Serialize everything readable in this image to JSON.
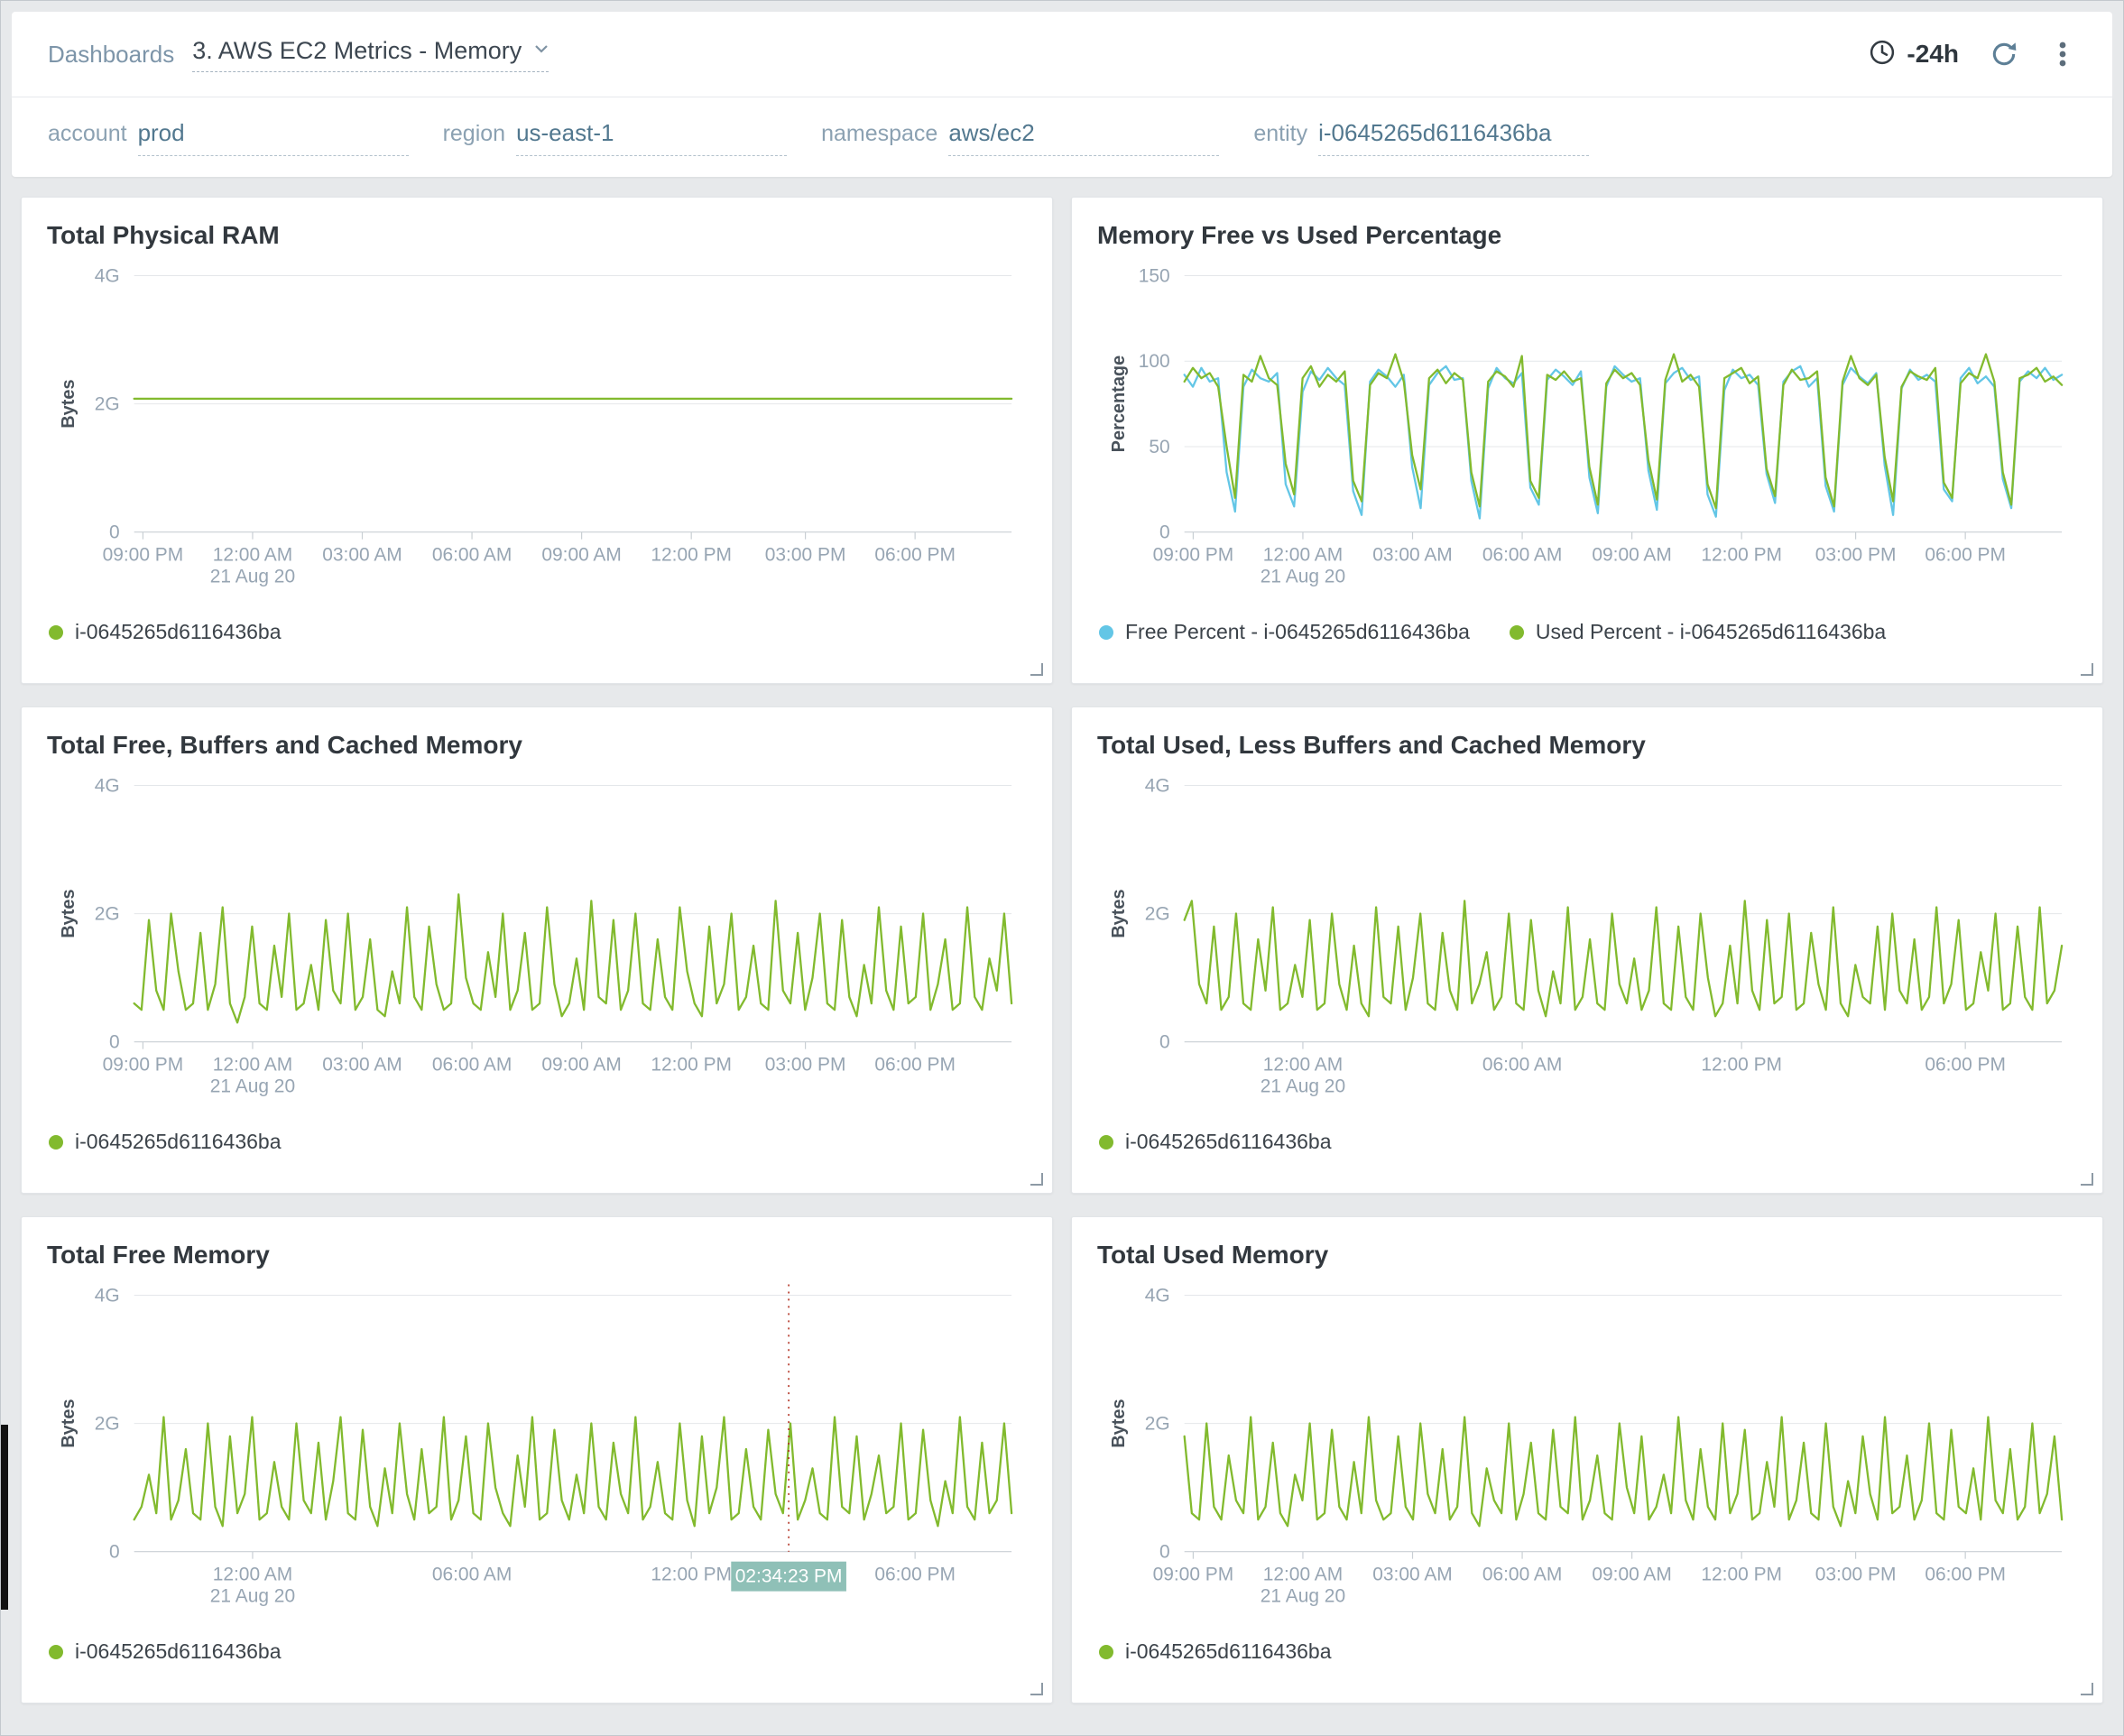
{
  "header": {
    "breadcrumb": "Dashboards",
    "dashboard_title": "3. AWS EC2 Metrics - Memory",
    "time_range": "-24h"
  },
  "filters": [
    {
      "label": "account",
      "value": "prod"
    },
    {
      "label": "region",
      "value": "us-east-1"
    },
    {
      "label": "namespace",
      "value": "aws/ec2"
    },
    {
      "label": "entity",
      "value": "i-0645265d6116436ba"
    }
  ],
  "colors": {
    "green": "#82ba2e",
    "blue": "#63c6e6",
    "cursor_red": "#b23121",
    "cursor_tag_bg": "#8fc0b7"
  },
  "chart_data": [
    {
      "type": "line",
      "title": "Total Physical RAM",
      "ylabel": "Bytes",
      "ymax": 4,
      "yticks": [
        {
          "value": 0,
          "label": "0"
        },
        {
          "value": 2,
          "label": "2G"
        },
        {
          "value": 4,
          "label": "4G"
        }
      ],
      "xticks": [
        {
          "pos": 0.01,
          "label": "09:00 PM"
        },
        {
          "pos": 0.135,
          "label": "12:00 AM",
          "sub": "21 Aug 20"
        },
        {
          "pos": 0.26,
          "label": "03:00 AM"
        },
        {
          "pos": 0.385,
          "label": "06:00 AM"
        },
        {
          "pos": 0.51,
          "label": "09:00 AM"
        },
        {
          "pos": 0.635,
          "label": "12:00 PM"
        },
        {
          "pos": 0.765,
          "label": "03:00 PM"
        },
        {
          "pos": 0.89,
          "label": "06:00 PM"
        }
      ],
      "series": [
        {
          "name": "i-0645265d6116436ba",
          "color": "#82ba2e",
          "values": [
            2.08,
            2.08,
            2.08,
            2.08,
            2.08,
            2.08,
            2.08,
            2.08,
            2.08,
            2.08,
            2.08,
            2.08
          ]
        }
      ]
    },
    {
      "type": "line",
      "title": "Memory Free vs Used Percentage",
      "ylabel": "Percentage",
      "ymax": 150,
      "yticks": [
        {
          "value": 0,
          "label": "0"
        },
        {
          "value": 50,
          "label": "50"
        },
        {
          "value": 100,
          "label": "100"
        },
        {
          "value": 150,
          "label": "150"
        }
      ],
      "xticks": [
        {
          "pos": 0.01,
          "label": "09:00 PM"
        },
        {
          "pos": 0.135,
          "label": "12:00 AM",
          "sub": "21 Aug 20"
        },
        {
          "pos": 0.26,
          "label": "03:00 AM"
        },
        {
          "pos": 0.385,
          "label": "06:00 AM"
        },
        {
          "pos": 0.51,
          "label": "09:00 AM"
        },
        {
          "pos": 0.635,
          "label": "12:00 PM"
        },
        {
          "pos": 0.765,
          "label": "03:00 PM"
        },
        {
          "pos": 0.89,
          "label": "06:00 PM"
        }
      ],
      "series": [
        {
          "name": "Free Percent - i-0645265d6116436ba",
          "color": "#63c6e6",
          "values": [
            92,
            85,
            96,
            88,
            90,
            35,
            12,
            85,
            95,
            90,
            88,
            93,
            28,
            15,
            82,
            94,
            89,
            96,
            90,
            86,
            24,
            10,
            88,
            95,
            91,
            85,
            92,
            38,
            14,
            86,
            93,
            97,
            89,
            90,
            30,
            8,
            84,
            96,
            90,
            87,
            93,
            26,
            16,
            89,
            95,
            91,
            86,
            94,
            32,
            11,
            85,
            97,
            92,
            88,
            90,
            36,
            13,
            87,
            93,
            96,
            89,
            91,
            22,
            9,
            83,
            95,
            90,
            92,
            86,
            34,
            17,
            88,
            94,
            97,
            85,
            90,
            27,
            12,
            86,
            96,
            91,
            87,
            93,
            39,
            10,
            84,
            95,
            89,
            92,
            88,
            25,
            18,
            90,
            96,
            87,
            91,
            85,
            31,
            14,
            88,
            94,
            90,
            96,
            89,
            92
          ]
        },
        {
          "name": "Used Percent - i-0645265d6116436ba",
          "color": "#82ba2e",
          "values": [
            88,
            96,
            90,
            93,
            85,
            50,
            20,
            92,
            88,
            103,
            90,
            86,
            40,
            22,
            90,
            97,
            85,
            92,
            88,
            94,
            30,
            18,
            86,
            93,
            90,
            104,
            88,
            45,
            25,
            90,
            95,
            87,
            93,
            89,
            35,
            15,
            88,
            94,
            91,
            85,
            103,
            30,
            20,
            92,
            89,
            94,
            88,
            90,
            38,
            16,
            87,
            95,
            90,
            93,
            86,
            42,
            19,
            89,
            104,
            88,
            92,
            85,
            28,
            14,
            90,
            93,
            96,
            87,
            91,
            37,
            21,
            86,
            95,
            89,
            90,
            94,
            32,
            15,
            88,
            103,
            90,
            86,
            92,
            44,
            18,
            85,
            94,
            91,
            89,
            96,
            29,
            20,
            87,
            93,
            90,
            104,
            88,
            35,
            16,
            90,
            92,
            96,
            88,
            91,
            86
          ]
        }
      ]
    },
    {
      "type": "line",
      "title": "Total Free, Buffers and Cached Memory",
      "ylabel": "Bytes",
      "ymax": 4,
      "yticks": [
        {
          "value": 0,
          "label": "0"
        },
        {
          "value": 2,
          "label": "2G"
        },
        {
          "value": 4,
          "label": "4G"
        }
      ],
      "xticks": [
        {
          "pos": 0.01,
          "label": "09:00 PM"
        },
        {
          "pos": 0.135,
          "label": "12:00 AM",
          "sub": "21 Aug 20"
        },
        {
          "pos": 0.26,
          "label": "03:00 AM"
        },
        {
          "pos": 0.385,
          "label": "06:00 AM"
        },
        {
          "pos": 0.51,
          "label": "09:00 AM"
        },
        {
          "pos": 0.635,
          "label": "12:00 PM"
        },
        {
          "pos": 0.765,
          "label": "03:00 PM"
        },
        {
          "pos": 0.89,
          "label": "06:00 PM"
        }
      ],
      "series": [
        {
          "name": "i-0645265d6116436ba",
          "color": "#82ba2e",
          "values": [
            0.6,
            0.5,
            1.9,
            0.8,
            0.5,
            2.0,
            1.1,
            0.5,
            0.6,
            1.7,
            0.5,
            0.9,
            2.1,
            0.6,
            0.3,
            0.7,
            1.8,
            0.6,
            0.5,
            1.5,
            0.7,
            2.0,
            0.5,
            0.6,
            1.2,
            0.5,
            1.9,
            0.8,
            0.6,
            2.0,
            0.5,
            0.7,
            1.6,
            0.5,
            0.4,
            1.1,
            0.6,
            2.1,
            0.7,
            0.5,
            1.8,
            0.9,
            0.5,
            0.6,
            2.3,
            1.0,
            0.6,
            0.5,
            1.4,
            0.7,
            2.0,
            0.5,
            0.8,
            1.7,
            0.5,
            0.6,
            2.1,
            0.9,
            0.4,
            0.6,
            1.3,
            0.5,
            2.2,
            0.7,
            0.6,
            1.9,
            0.5,
            0.8,
            2.0,
            0.6,
            0.5,
            1.6,
            0.7,
            0.5,
            2.1,
            1.1,
            0.6,
            0.4,
            1.8,
            0.6,
            0.9,
            2.0,
            0.5,
            0.7,
            1.5,
            0.6,
            0.5,
            2.2,
            0.8,
            0.6,
            1.7,
            0.5,
            1.0,
            2.0,
            0.6,
            0.5,
            1.9,
            0.7,
            0.4,
            1.2,
            0.6,
            2.1,
            0.8,
            0.5,
            1.8,
            0.6,
            0.7,
            2.0,
            0.5,
            0.9,
            1.6,
            0.5,
            0.6,
            2.1,
            0.7,
            0.5,
            1.3,
            0.8,
            2.0,
            0.6
          ]
        }
      ]
    },
    {
      "type": "line",
      "title": "Total Used, Less Buffers and Cached Memory",
      "ylabel": "Bytes",
      "ymax": 4,
      "yticks": [
        {
          "value": 0,
          "label": "0"
        },
        {
          "value": 2,
          "label": "2G"
        },
        {
          "value": 4,
          "label": "4G"
        }
      ],
      "xticks": [
        {
          "pos": 0.135,
          "label": "12:00 AM",
          "sub": "21 Aug 20"
        },
        {
          "pos": 0.385,
          "label": "06:00 AM"
        },
        {
          "pos": 0.635,
          "label": "12:00 PM"
        },
        {
          "pos": 0.89,
          "label": "06:00 PM"
        }
      ],
      "series": [
        {
          "name": "i-0645265d6116436ba",
          "color": "#82ba2e",
          "values": [
            1.9,
            2.2,
            0.9,
            0.6,
            1.8,
            0.5,
            0.7,
            2.0,
            0.6,
            0.5,
            1.6,
            0.8,
            2.1,
            0.5,
            0.6,
            1.2,
            0.7,
            1.9,
            0.5,
            0.6,
            2.0,
            0.9,
            0.5,
            1.5,
            0.6,
            0.4,
            2.1,
            0.7,
            0.6,
            1.8,
            0.5,
            1.0,
            2.0,
            0.6,
            0.5,
            1.7,
            0.8,
            0.5,
            2.2,
            0.6,
            0.9,
            1.4,
            0.5,
            0.7,
            2.0,
            0.6,
            0.5,
            1.9,
            0.8,
            0.4,
            1.1,
            0.6,
            2.1,
            0.5,
            0.7,
            1.6,
            0.6,
            0.5,
            2.0,
            0.9,
            0.6,
            1.3,
            0.5,
            0.8,
            2.1,
            0.6,
            0.5,
            1.8,
            0.7,
            0.5,
            2.0,
            1.0,
            0.4,
            0.6,
            1.5,
            0.6,
            2.2,
            0.8,
            0.5,
            1.9,
            0.6,
            0.7,
            2.0,
            0.5,
            0.6,
            1.7,
            0.9,
            0.5,
            2.1,
            0.6,
            0.4,
            1.2,
            0.7,
            0.6,
            1.8,
            0.5,
            2.0,
            0.8,
            0.6,
            1.6,
            0.5,
            0.7,
            2.1,
            0.6,
            0.9,
            1.9,
            0.5,
            0.6,
            1.4,
            0.8,
            2.0,
            0.5,
            0.6,
            1.8,
            0.7,
            0.5,
            2.1,
            0.6,
            0.8,
            1.5
          ]
        }
      ]
    },
    {
      "type": "line",
      "title": "Total Free Memory",
      "ylabel": "Bytes",
      "ymax": 4,
      "yticks": [
        {
          "value": 0,
          "label": "0"
        },
        {
          "value": 2,
          "label": "2G"
        },
        {
          "value": 4,
          "label": "4G"
        }
      ],
      "xticks": [
        {
          "pos": 0.135,
          "label": "12:00 AM",
          "sub": "21 Aug 20"
        },
        {
          "pos": 0.385,
          "label": "06:00 AM"
        },
        {
          "pos": 0.635,
          "label": "12:00 PM"
        },
        {
          "pos": 0.89,
          "label": "06:00 PM"
        }
      ],
      "cursor": {
        "pos": 0.746,
        "label": "02:34:23 PM"
      },
      "series": [
        {
          "name": "i-0645265d6116436ba",
          "color": "#82ba2e",
          "values": [
            0.5,
            0.7,
            1.2,
            0.6,
            2.1,
            0.5,
            0.8,
            1.6,
            0.6,
            0.5,
            2.0,
            0.7,
            0.4,
            1.8,
            0.6,
            0.9,
            2.1,
            0.5,
            0.6,
            1.4,
            0.7,
            0.5,
            2.0,
            0.8,
            0.6,
            1.7,
            0.5,
            1.1,
            2.1,
            0.6,
            0.5,
            1.9,
            0.7,
            0.4,
            1.3,
            0.6,
            2.0,
            0.9,
            0.5,
            1.6,
            0.6,
            0.7,
            2.1,
            0.5,
            0.8,
            1.8,
            0.6,
            0.5,
            2.0,
            1.0,
            0.6,
            0.4,
            1.5,
            0.7,
            2.1,
            0.5,
            0.6,
            1.9,
            0.8,
            0.5,
            1.2,
            0.6,
            2.0,
            0.7,
            0.5,
            1.7,
            0.9,
            0.6,
            2.1,
            0.5,
            0.7,
            1.4,
            0.6,
            0.5,
            2.0,
            0.8,
            0.4,
            1.8,
            0.6,
            1.0,
            2.1,
            0.5,
            0.6,
            1.6,
            0.7,
            0.5,
            1.9,
            0.9,
            0.6,
            2.0,
            0.5,
            0.8,
            1.3,
            0.6,
            0.5,
            2.1,
            0.7,
            0.6,
            1.8,
            0.5,
            0.9,
            1.5,
            0.6,
            0.7,
            2.0,
            0.5,
            0.6,
            1.9,
            0.8,
            0.4,
            1.1,
            0.6,
            2.1,
            0.7,
            0.5,
            1.7,
            0.6,
            0.8,
            2.0,
            0.6
          ]
        }
      ]
    },
    {
      "type": "line",
      "title": "Total Used Memory",
      "ylabel": "Bytes",
      "ymax": 4,
      "yticks": [
        {
          "value": 0,
          "label": "0"
        },
        {
          "value": 2,
          "label": "2G"
        },
        {
          "value": 4,
          "label": "4G"
        }
      ],
      "xticks": [
        {
          "pos": 0.01,
          "label": "09:00 PM"
        },
        {
          "pos": 0.135,
          "label": "12:00 AM",
          "sub": "21 Aug 20"
        },
        {
          "pos": 0.26,
          "label": "03:00 AM"
        },
        {
          "pos": 0.385,
          "label": "06:00 AM"
        },
        {
          "pos": 0.51,
          "label": "09:00 AM"
        },
        {
          "pos": 0.635,
          "label": "12:00 PM"
        },
        {
          "pos": 0.765,
          "label": "03:00 PM"
        },
        {
          "pos": 0.89,
          "label": "06:00 PM"
        }
      ],
      "series": [
        {
          "name": "i-0645265d6116436ba",
          "color": "#82ba2e",
          "values": [
            1.8,
            0.6,
            0.5,
            2.0,
            0.7,
            0.5,
            1.5,
            0.8,
            0.6,
            2.1,
            0.5,
            0.7,
            1.7,
            0.6,
            0.4,
            1.2,
            0.8,
            2.0,
            0.5,
            0.6,
            1.9,
            0.7,
            0.5,
            1.4,
            0.6,
            2.1,
            0.8,
            0.5,
            0.6,
            1.8,
            0.7,
            0.5,
            2.0,
            0.9,
            0.6,
            1.6,
            0.5,
            0.7,
            2.1,
            0.6,
            0.4,
            1.3,
            0.8,
            0.6,
            2.0,
            0.5,
            0.9,
            1.7,
            0.6,
            0.5,
            1.9,
            0.7,
            0.6,
            2.1,
            0.5,
            0.8,
            1.5,
            0.6,
            0.5,
            2.0,
            1.0,
            0.6,
            1.8,
            0.5,
            0.7,
            1.2,
            0.6,
            2.1,
            0.8,
            0.5,
            1.6,
            0.7,
            0.5,
            2.0,
            0.6,
            0.9,
            1.9,
            0.5,
            0.6,
            1.4,
            0.7,
            2.1,
            0.5,
            0.8,
            1.7,
            0.6,
            0.5,
            2.0,
            0.7,
            0.4,
            1.1,
            0.6,
            1.8,
            0.9,
            0.5,
            2.1,
            0.6,
            0.7,
            1.5,
            0.5,
            0.8,
            2.0,
            0.6,
            0.5,
            1.9,
            0.7,
            0.6,
            1.3,
            0.5,
            2.1,
            0.8,
            0.6,
            1.6,
            0.5,
            0.7,
            2.0,
            0.6,
            0.9,
            1.8,
            0.5
          ]
        }
      ]
    }
  ]
}
